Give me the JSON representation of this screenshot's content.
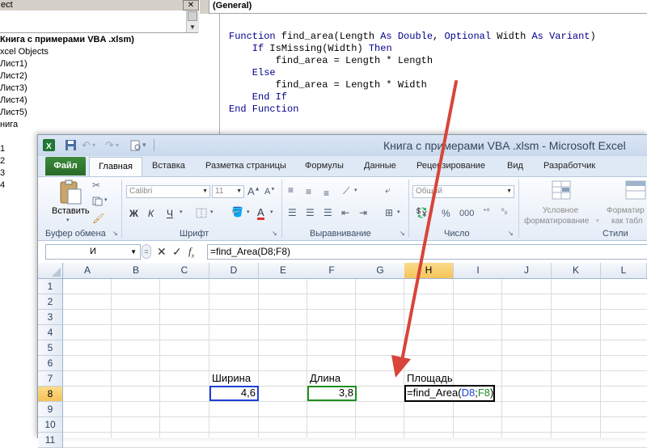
{
  "vbe": {
    "project_title": "ect",
    "close_glyph": "✕",
    "tree": [
      "Книга с примерами VBA .xlsm)",
      "xcel Objects",
      "Лист1)",
      "Лист2)",
      "Лист3)",
      "Лист4)",
      "Лист5)",
      "нига",
      "1",
      "2",
      "3",
      "4"
    ],
    "code_combo": "(General)",
    "code_lines": [
      {
        "kw1": "Function",
        "rest": " find_area(Length ",
        "kw2": "As Double",
        "rest2": ", ",
        "kw3": "Optional",
        "rest3": " Width ",
        "kw4": "As Variant",
        "rest4": ")"
      },
      {
        "kw1": "    If",
        "rest": " IsMissing(Width) ",
        "kw2": "Then",
        "rest2": "",
        "kw3": "",
        "rest3": "",
        "kw4": "",
        "rest4": ""
      },
      {
        "kw1": "",
        "rest": "        find_area = Length * Length",
        "kw2": "",
        "rest2": "",
        "kw3": "",
        "rest3": "",
        "kw4": "",
        "rest4": ""
      },
      {
        "kw1": "    Else",
        "rest": "",
        "kw2": "",
        "rest2": "",
        "kw3": "",
        "rest3": "",
        "kw4": "",
        "rest4": ""
      },
      {
        "kw1": "",
        "rest": "        find_area = Length * Width",
        "kw2": "",
        "rest2": "",
        "kw3": "",
        "rest3": "",
        "kw4": "",
        "rest4": ""
      },
      {
        "kw1": "    End If",
        "rest": "",
        "kw2": "",
        "rest2": "",
        "kw3": "",
        "rest3": "",
        "kw4": "",
        "rest4": ""
      },
      {
        "kw1": "End Function",
        "rest": "",
        "kw2": "",
        "rest2": "",
        "kw3": "",
        "rest3": "",
        "kw4": "",
        "rest4": ""
      }
    ]
  },
  "excel": {
    "title": "Книга с примерами VBA .xlsm  -  Microsoft Excel",
    "tabs": {
      "file": "Файл",
      "home": "Главная",
      "insert": "Вставка",
      "layout": "Разметка страницы",
      "formulas": "Формулы",
      "data": "Данные",
      "review": "Рецензирование",
      "view": "Вид",
      "developer": "Разработчик"
    },
    "ribbon": {
      "paste_label": "Вставить",
      "font_name": "Calibri",
      "font_size": "11",
      "number_format": "Общий",
      "conditional_format_1": "Условное",
      "conditional_format_2": "форматирование",
      "format_table_1": "Форматир",
      "format_table_2": "как табл",
      "bold": "Ж",
      "italic": "К",
      "underline": "Ч",
      "percent": "%",
      "thousands": "000",
      "groups": {
        "clipboard": "Буфер обмена",
        "font": "Шрифт",
        "alignment": "Выравнивание",
        "number": "Число",
        "styles": "Стили"
      }
    },
    "name_box": "И",
    "formula": "=find_Area(D8;F8)",
    "columns": [
      "A",
      "B",
      "C",
      "D",
      "E",
      "F",
      "G",
      "H",
      "I",
      "J",
      "K",
      "L"
    ],
    "rows": [
      "1",
      "2",
      "3",
      "4",
      "5",
      "6",
      "7",
      "8",
      "9",
      "10",
      "11"
    ],
    "cells": {
      "D7": "Ширина",
      "F7": "Длина",
      "H7": "Площадь",
      "D8": "4,6",
      "F8": "3,8",
      "H8_prefix": "=find_Area(",
      "H8_ref1": "D8",
      "H8_sep": ";",
      "H8_ref2": "F8",
      "H8_suffix": ")"
    },
    "colors": {
      "ref1": "#1f3fd8",
      "ref2": "#1f8f1f",
      "arrow": "#d8453a",
      "file_tab": "#2f7a2f"
    }
  }
}
